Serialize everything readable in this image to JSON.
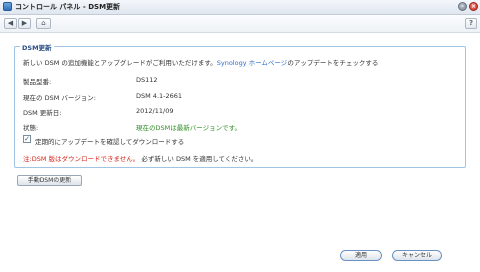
{
  "window": {
    "title": "コントロール パネル - DSM更新",
    "minimize_icon": "minimize-icon",
    "close_icon": "close-icon"
  },
  "toolbar": {
    "back": "◀",
    "forward": "▶",
    "home": "⌂",
    "help": "?"
  },
  "section": {
    "legend": "DSM更新",
    "description_before": "新しい DSM の追加機能とアップグレードがご利用いただけます。",
    "description_link": "Synology ホームページ",
    "description_after": "のアップデートをチェックする"
  },
  "info": {
    "model_label": "製品型番:",
    "model_value": "DS112",
    "version_label": "現在の DSM バージョン:",
    "version_value": "DSM 4.1-2661",
    "date_label": "DSM 更新日:",
    "date_value": "2012/11/09",
    "status_label": "状態:",
    "status_value": "現在のDSMは最新バージョンです。"
  },
  "auto_update": {
    "checked": true,
    "label": "定期的にアップデートを確認してダウンロードする"
  },
  "note": {
    "warning": "注:DSM 版はダウンロードできません。",
    "after": " 必ず新しい DSM を適用してください。"
  },
  "buttons": {
    "manual_update": "手動DSMの更新",
    "apply": "適用",
    "cancel": "キャンセル"
  },
  "colors": {
    "accent": "#2f6fd0",
    "status_ok": "#2e8f26",
    "warning": "#d6261b",
    "legend": "#2a4f86"
  }
}
